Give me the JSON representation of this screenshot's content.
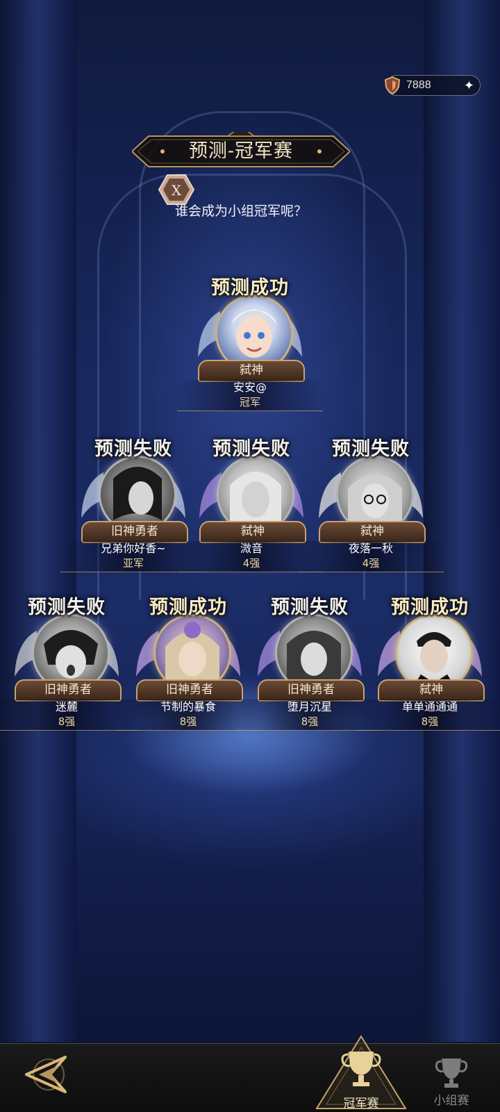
{
  "header": {
    "currency_amount": "7888",
    "title": "预测-冠军赛",
    "badge_letter": "X",
    "subtitle": "谁会成为小组冠军呢？"
  },
  "champion": {
    "result": "预测成功",
    "rank": "弑神",
    "name": "安安@",
    "place": "冠军",
    "status": "success"
  },
  "semifinal": [
    {
      "result": "预测失败",
      "rank": "旧神勇者",
      "name": "兄弟你好香~",
      "place": "亚军",
      "status": "fail"
    },
    {
      "result": "预测失败",
      "rank": "弑神",
      "name": "溦音",
      "place": "4强",
      "status": "fail"
    },
    {
      "result": "预测失败",
      "rank": "弑神",
      "name": "夜落一秋",
      "place": "4强",
      "status": "fail"
    }
  ],
  "quarterfinal": [
    {
      "result": "预测失败",
      "rank": "旧神勇者",
      "name": "迷麓",
      "place": "8强",
      "status": "fail"
    },
    {
      "result": "预测成功",
      "rank": "旧神勇者",
      "name": "节制的暴食",
      "place": "8强",
      "status": "success"
    },
    {
      "result": "预测失败",
      "rank": "旧神勇者",
      "name": "堕月沉星",
      "place": "8强",
      "status": "fail"
    },
    {
      "result": "预测成功",
      "rank": "弑神",
      "name": "单单通通通",
      "place": "8强",
      "status": "success"
    }
  ],
  "nav": {
    "champion_tab": "冠军赛",
    "group_tab": "小组赛"
  },
  "icons": [
    "shield-coin-icon",
    "sparkle-icon",
    "back-arrow-icon",
    "trophy-icon"
  ],
  "colors": {
    "gold": "#c9a46a",
    "accent_text": "#f0d79c"
  }
}
